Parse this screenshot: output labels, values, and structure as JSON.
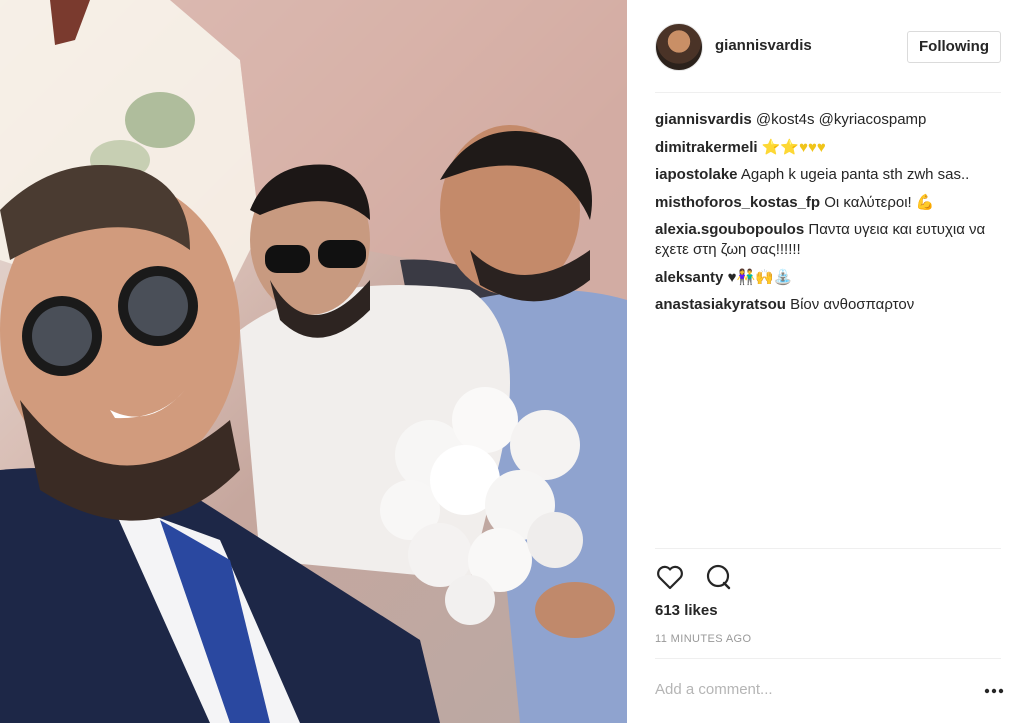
{
  "header": {
    "username": "giannisvardis",
    "follow_label": "Following"
  },
  "comments": [
    {
      "user": "giannisvardis",
      "text": "@kost4s @kyriacospamp"
    },
    {
      "user": "dimitrakermeli",
      "text": "⭐⭐♥♥♥"
    },
    {
      "user": "iapostolake",
      "text": "Agaph k ugeia panta sth zwh sas.."
    },
    {
      "user": "misthoforos_kostas_fp",
      "text": "Οι καλύτεροι! 💪"
    },
    {
      "user": "alexia.sgoubopoulos",
      "text": "Παντα υγεια και ευτυχια να εχετε στη ζωη σας!!!!!!"
    },
    {
      "user": "aleksanty",
      "text": "♥👫🙌⛲"
    },
    {
      "user": "anastasiakyratsou",
      "text": "Βίον ανθοσπαρτον"
    }
  ],
  "actions": {
    "like_icon": "heart-outline-icon",
    "comment_icon": "speech-bubble-icon"
  },
  "likes_text": "613 likes",
  "time_text": "11 MINUTES AGO",
  "add_comment_placeholder": "Add a comment...",
  "colors": {
    "text": "#262626",
    "muted": "#999999",
    "divider": "#efefef",
    "star": "#f0c419"
  }
}
